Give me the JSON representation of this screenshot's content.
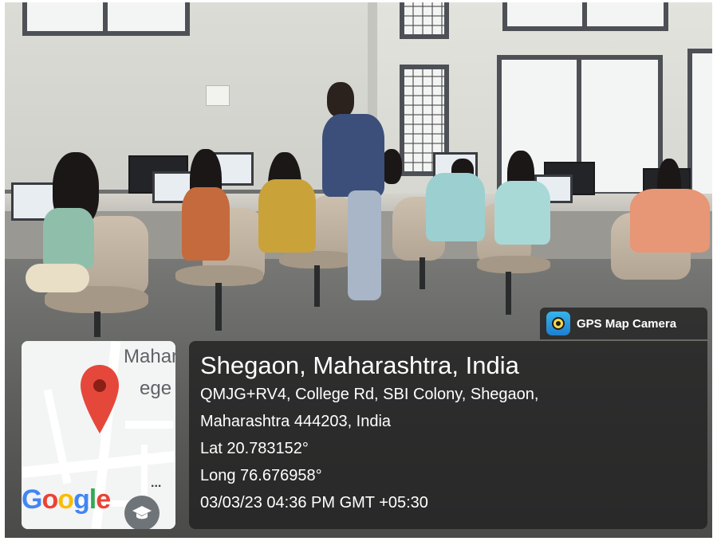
{
  "overlay": {
    "app_name": "GPS Map Camera",
    "location_title": "Shegaon, Maharashtra, India",
    "address_line_1": "QMJG+RV4, College Rd, SBI Colony, Shegaon,",
    "address_line_2": "Maharashtra 444203, India",
    "latitude": "Lat 20.783152°",
    "longitude": "Long 76.676958°",
    "timestamp": "03/03/23 04:36 PM GMT +05:30"
  },
  "map": {
    "label_top": "Mahara",
    "label_mid": "ege C",
    "brand_letters": [
      "G",
      "o",
      "o",
      "g",
      "l",
      "e"
    ],
    "brand_colors": [
      "#4285f4",
      "#ea4335",
      "#fbbc05",
      "#4285f4",
      "#34a853",
      "#ea4335"
    ],
    "more_glyph": "...",
    "pin_color": "#e5483b",
    "education_icon": "graduation-cap-icon"
  },
  "colors": {
    "overlay_bg": "#232323",
    "app_icon": "#2a93dd"
  }
}
